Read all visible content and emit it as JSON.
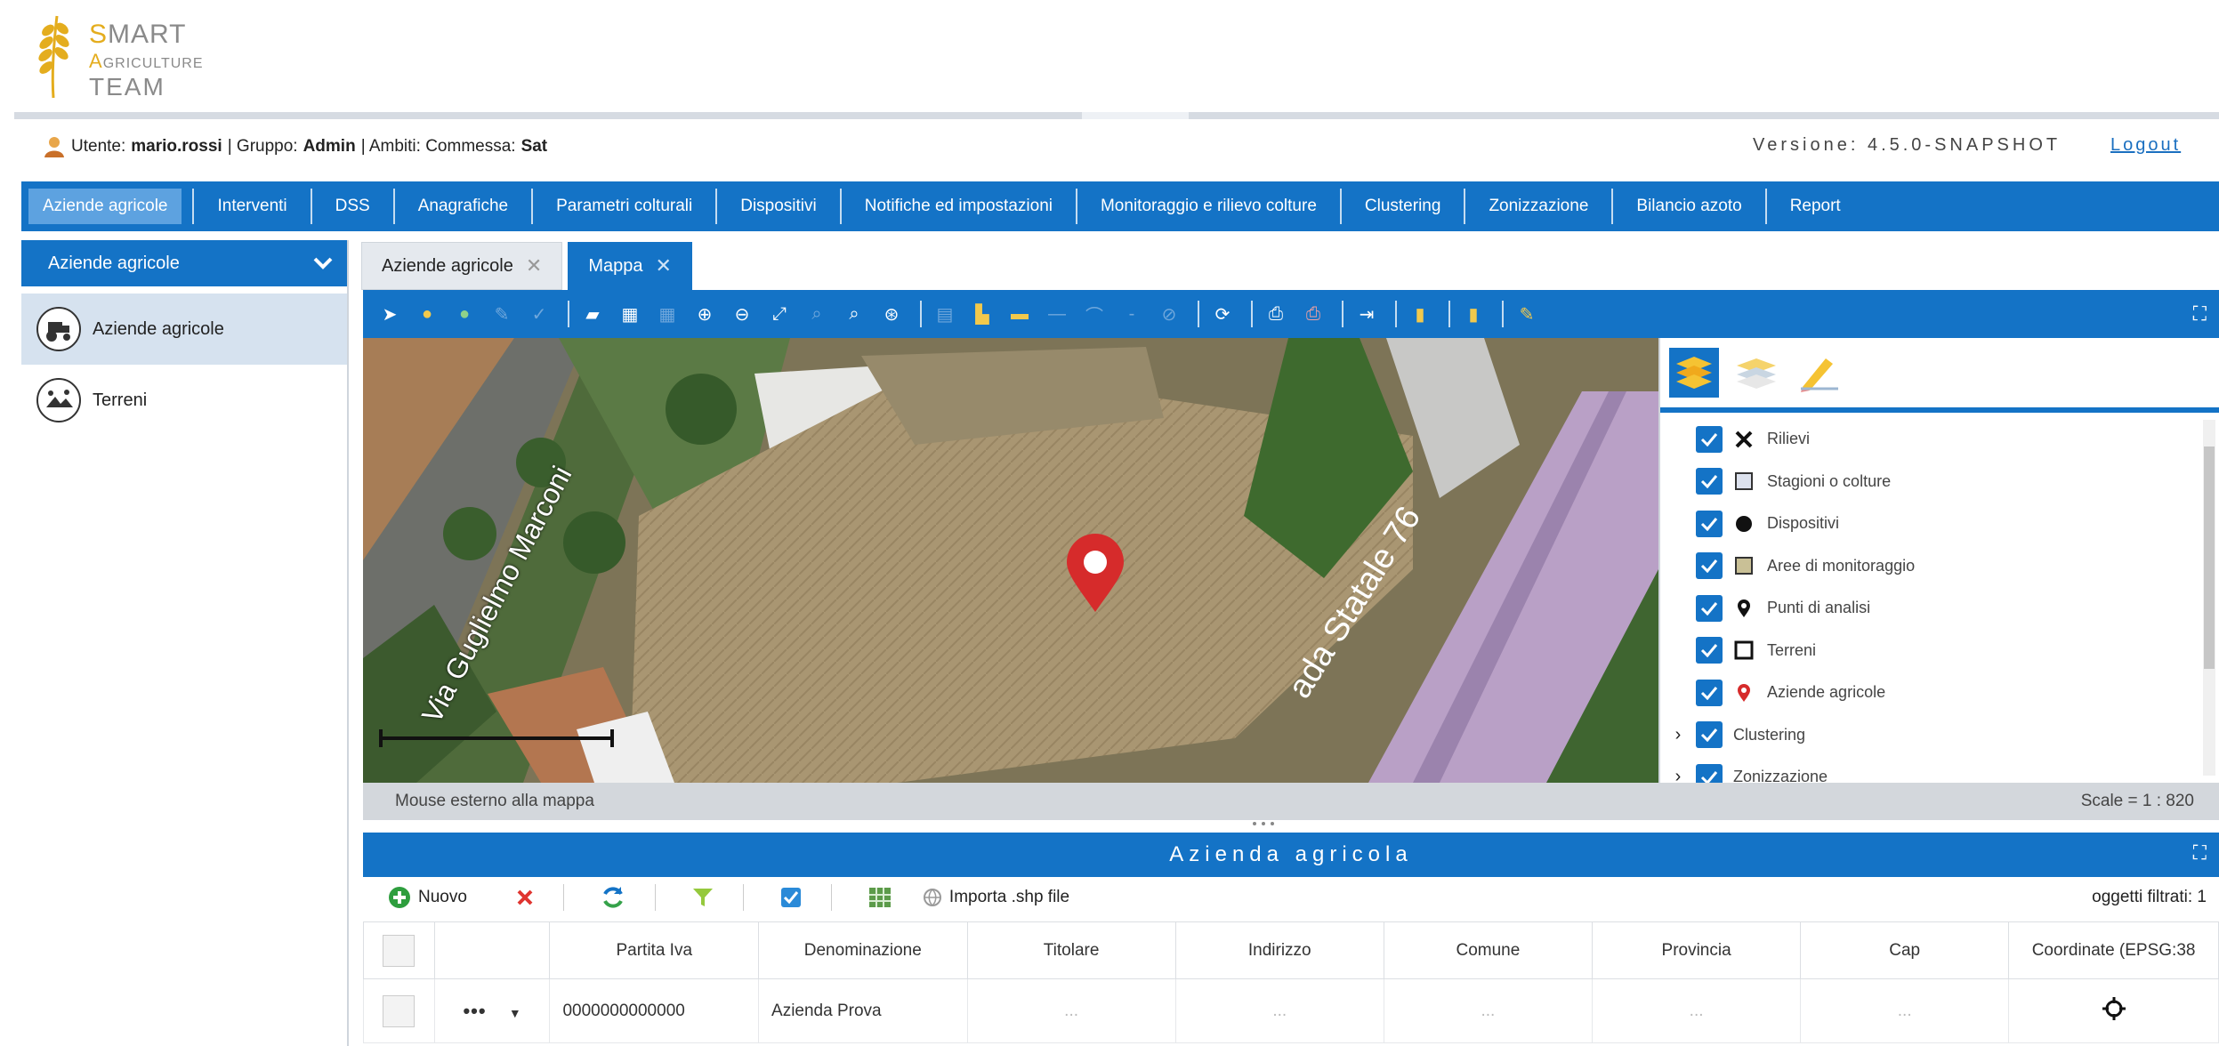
{
  "logo": {
    "line1_cap": "S",
    "line1_rest": "MART",
    "line2_cap": "A",
    "line2_rest": "GRICULTURE",
    "line3_rest": "TEAM"
  },
  "userbar": {
    "user_prefix": "Utente:",
    "user": "mario.rossi",
    "group_prefix": "| Gruppo:",
    "group": "Admin",
    "scope_prefix": "| Ambiti: Commessa:",
    "scope": "Sat"
  },
  "version": "Versione: 4.5.0-SNAPSHOT",
  "logout": "Logout",
  "menu": [
    "Aziende agricole",
    "Interventi",
    "DSS",
    "Anagrafiche",
    "Parametri colturali",
    "Dispositivi",
    "Notifiche ed impostazioni",
    "Monitoraggio e rilievo colture",
    "Clustering",
    "Zonizzazione",
    "Bilancio azoto",
    "Report"
  ],
  "sidebar": {
    "header": "Aziende agricole",
    "items": [
      {
        "label": "Aziende agricole"
      },
      {
        "label": "Terreni"
      }
    ]
  },
  "tabs": [
    {
      "label": "Aziende agricole"
    },
    {
      "label": "Mappa"
    }
  ],
  "map": {
    "road_label": "Via Guglielmo Marconi",
    "highway_label": "ada Statale 76",
    "status": "Mouse esterno alla mappa",
    "scale": "Scale = 1 : 820"
  },
  "layers": [
    {
      "label": "Rilievi",
      "symbol": "x-icon",
      "expandable": false
    },
    {
      "label": "Stagioni o colture",
      "symbol": "square-icon",
      "expandable": false
    },
    {
      "label": "Dispositivi",
      "symbol": "dot-icon",
      "expandable": false
    },
    {
      "label": "Aree di monitoraggio",
      "symbol": "filled-square-icon",
      "expandable": false
    },
    {
      "label": "Punti di analisi",
      "symbol": "pin-icon",
      "expandable": false
    },
    {
      "label": "Terreni",
      "symbol": "empty-square-icon",
      "expandable": false
    },
    {
      "label": "Aziende agricole",
      "symbol": "red-pin-icon",
      "expandable": false
    },
    {
      "label": "Clustering",
      "symbol": "",
      "expandable": true
    },
    {
      "label": "Zonizzazione",
      "symbol": "",
      "expandable": true
    }
  ],
  "grid": {
    "title": "Azienda agricola",
    "tools": {
      "new": "Nuovo",
      "import": "Importa .shp file",
      "filtered": "oggetti filtrati: 1"
    },
    "columns": [
      "",
      "",
      "Partita Iva",
      "Denominazione",
      "Titolare",
      "Indirizzo",
      "Comune",
      "Provincia",
      "Cap",
      "Coordinate (EPSG:38"
    ],
    "rows": [
      {
        "partita_iva": "0000000000000",
        "denominazione": "Azienda Prova",
        "titolare": "...",
        "indirizzo": "...",
        "comune": "...",
        "provincia": "...",
        "cap": "..."
      }
    ]
  },
  "colors": {
    "primary": "#1473c6",
    "accent": "#e4ad1e",
    "marker": "#d62b2b"
  }
}
